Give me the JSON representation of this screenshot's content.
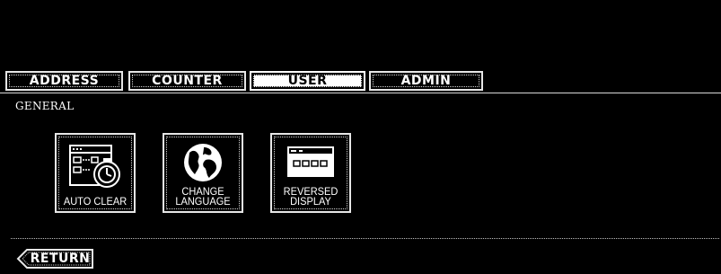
{
  "tabs": [
    {
      "label": "ADDRESS",
      "active": false
    },
    {
      "label": "COUNTER",
      "active": false
    },
    {
      "label": "USER",
      "active": true
    },
    {
      "label": "ADMIN",
      "active": false
    }
  ],
  "section": {
    "label": "GENERAL"
  },
  "buttons": {
    "auto_clear": {
      "line1": "AUTO CLEAR",
      "icon": "auto-clear-timer-icon"
    },
    "change_language": {
      "line1": "CHANGE",
      "line2": "LANGUAGE",
      "icon": "globe-icon"
    },
    "reversed_display": {
      "line1": "REVERSED",
      "line2": "DISPLAY",
      "icon": "display-panel-icon"
    }
  },
  "footer": {
    "return_label": "RETURN"
  },
  "colors": {
    "background": "#000000",
    "foreground": "#ffffff",
    "active_tab_bg": "#ffffff"
  }
}
